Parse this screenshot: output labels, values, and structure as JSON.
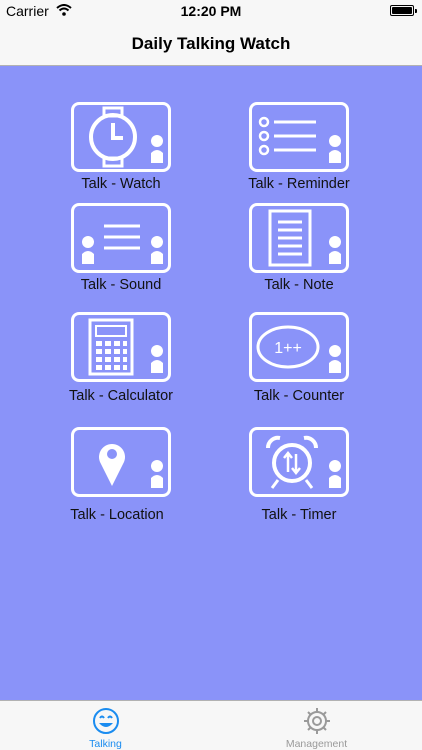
{
  "status_bar": {
    "carrier": "Carrier",
    "time": "12:20 PM"
  },
  "nav": {
    "title": "Daily Talking Watch"
  },
  "tiles": [
    {
      "label": "Talk - Watch",
      "icon": "watch-icon"
    },
    {
      "label": "Talk - Reminder",
      "icon": "reminder-list-icon"
    },
    {
      "label": "Talk - Sound",
      "icon": "sound-icon"
    },
    {
      "label": "Talk - Note",
      "icon": "note-icon"
    },
    {
      "label": "Talk - Calculator",
      "icon": "calculator-icon"
    },
    {
      "label": "Talk - Counter",
      "icon": "counter-icon"
    },
    {
      "label": "Talk - Location",
      "icon": "location-pin-icon"
    },
    {
      "label": "Talk - Timer",
      "icon": "alarm-clock-icon"
    }
  ],
  "tab_bar": {
    "items": [
      {
        "label": "Talking",
        "icon": "smiley-icon",
        "selected": true
      },
      {
        "label": "Management",
        "icon": "gear-icon",
        "selected": false
      }
    ]
  },
  "colors": {
    "background": "#8a93f9",
    "tile_border": "#ffffff",
    "tab_active": "#1a8cf0",
    "tab_inactive": "#9a9a9a"
  }
}
